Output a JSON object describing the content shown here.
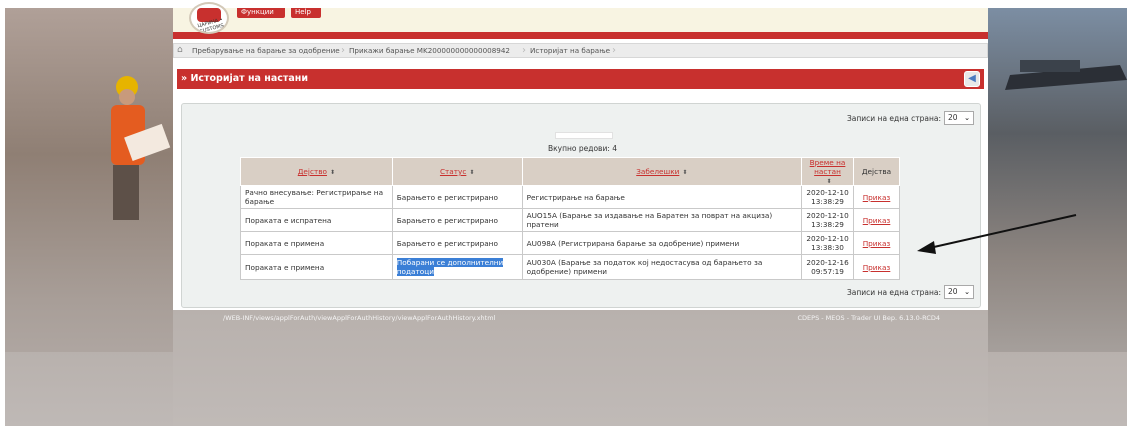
{
  "header": {
    "logo_text": "ЦАРИНА • CUSTOMS",
    "buttons": [
      "Функции",
      "Help"
    ]
  },
  "breadcrumb": [
    "Пребарување на барање за одобрение",
    "Прикажи барање MK200000000000008942",
    "Историјат на барање"
  ],
  "panel": {
    "title": "» Историјат на настани"
  },
  "pager": {
    "label": "Записи на една страна:",
    "value": "20"
  },
  "total_rows": "Вкупно редови: 4",
  "table": {
    "columns": [
      "Дејство",
      "Статус",
      "Забелешки",
      "Време на настан",
      "Дејства"
    ],
    "rows": [
      {
        "action": "Рачно внесување: Регистрирање на барање",
        "status": "Барањето е регистрирано",
        "note": "Регистрирање на барање",
        "time_date": "2020-12-10",
        "time_clock": "13:38:29",
        "link": "Приказ"
      },
      {
        "action": "Пораката е испратена",
        "status": "Барањето е регистрирано",
        "note": "AUO15A (Барање за издавање на Баратен за поврат на акциза) пратени",
        "time_date": "2020-12-10",
        "time_clock": "13:38:29",
        "link": "Приказ"
      },
      {
        "action": "Пораката е примена",
        "status": "Барањето е регистрирано",
        "note": "AU098A (Регистрирана барање за одобрение) примени",
        "time_date": "2020-12-10",
        "time_clock": "13:38:30",
        "link": "Приказ"
      },
      {
        "action": "Пораката е примена",
        "status": "Побарани се дополнителни податоци",
        "note": "AU030A (Барање за податок кој недостасува од барањето за одобрение) примени",
        "time_date": "2020-12-16",
        "time_clock": "09:57:19",
        "link": "Приказ"
      }
    ]
  },
  "footer": {
    "path": "/WEB-INF/views/applForAuth/viewApplForAuthHistory/viewApplForAuthHistory.xhtml",
    "version": "CDEPS - MEOS - Trader UI Вер. 6.13.0-RCD4"
  },
  "colors": {
    "brand_red": "#c8302e",
    "header_cell": "#d9cfc5",
    "selection_blue": "#3b7fd6"
  }
}
